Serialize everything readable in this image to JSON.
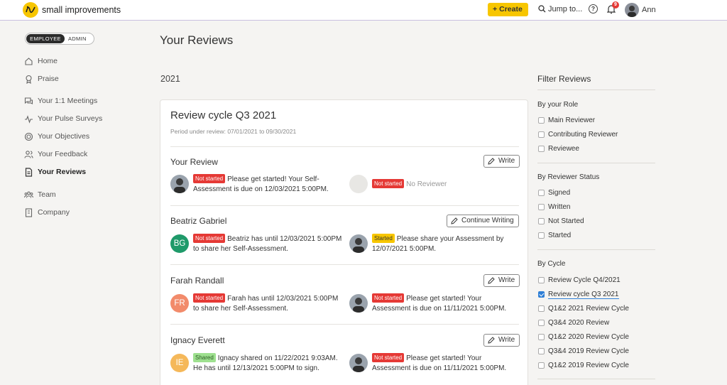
{
  "app": {
    "brand": "small improvements",
    "create_label": "Create",
    "jump_label": "Jump to...",
    "help_label": "?",
    "notifications_count": "9",
    "user_name": "Ann"
  },
  "sidebar": {
    "mode_employee": "EMPLOYEE",
    "mode_admin": "ADMIN",
    "items": [
      {
        "label": "Home",
        "icon": "home-icon"
      },
      {
        "label": "Praise",
        "icon": "badge-icon"
      },
      {
        "label": "Your 1:1 Meetings",
        "icon": "chat-icon"
      },
      {
        "label": "Your Pulse Surveys",
        "icon": "pulse-icon"
      },
      {
        "label": "Your Objectives",
        "icon": "target-icon"
      },
      {
        "label": "Your Feedback",
        "icon": "people-icon"
      },
      {
        "label": "Your Reviews",
        "icon": "document-icon",
        "active": true
      },
      {
        "label": "Team",
        "icon": "team-icon"
      },
      {
        "label": "Company",
        "icon": "building-icon"
      }
    ]
  },
  "main": {
    "page_title": "Your Reviews",
    "year": "2021",
    "cycle": {
      "title": "Review cycle Q3 2021",
      "period": "Period under review: 07/01/2021 to 09/30/2021"
    },
    "sections": [
      {
        "name": "Your Review",
        "action": "Write",
        "left_badge": "Not started",
        "left_text": "Please get started! Your Self-Assessment is due on 12/03/2021 5:00PM.",
        "right_badge": "Not started",
        "right_text": "No Reviewer"
      },
      {
        "name": "Beatriz Gabriel",
        "initials": "BG",
        "action": "Continue Writing",
        "left_badge": "Not started",
        "left_text": "Beatriz has until 12/03/2021 5:00PM to share her Self-Assessment.",
        "right_badge": "Started",
        "right_text": "Please share your Assessment by 12/07/2021 5:00PM."
      },
      {
        "name": "Farah Randall",
        "initials": "FR",
        "action": "Write",
        "left_badge": "Not started",
        "left_text": "Farah has until 12/03/2021 5:00PM to share her Self-Assessment.",
        "right_badge": "Not started",
        "right_text": "Please get started! Your Assessment is due on 11/11/2021 5:00PM."
      },
      {
        "name": "Ignacy Everett",
        "initials": "IE",
        "action": "Write",
        "left_badge": "Shared",
        "left_text": "Ignacy shared on 11/22/2021 9:03AM. He has until 12/13/2021 5:00PM to sign.",
        "right_badge": "Not started",
        "right_text": "Please get started! Your Assessment is due on 11/11/2021 5:00PM."
      }
    ]
  },
  "filters": {
    "title": "Filter Reviews",
    "groups": [
      {
        "title": "By your Role",
        "items": [
          "Main Reviewer",
          "Contributing Reviewer",
          "Reviewee"
        ]
      },
      {
        "title": "By Reviewer Status",
        "items": [
          "Signed",
          "Written",
          "Not Started",
          "Started"
        ]
      },
      {
        "title": "By Cycle",
        "items": [
          "Review Cycle Q4/2021",
          "Review cycle Q3 2021",
          "Q1&2 2021 Review Cycle",
          "Q3&4 2020 Review",
          "Q1&2 2020 Review Cycle",
          "Q3&4 2019 Review Cycle",
          "Q1&2 2019 Review Cycle"
        ],
        "checked_index": 1
      }
    ]
  },
  "colors": {
    "accent": "#f7c600",
    "danger": "#e53935",
    "checked": "#2f7fd6",
    "bg_initials_bg": "#1f9a6a",
    "bg_initials_fr": "#f28b6b",
    "bg_initials_ie": "#f5b85a"
  }
}
